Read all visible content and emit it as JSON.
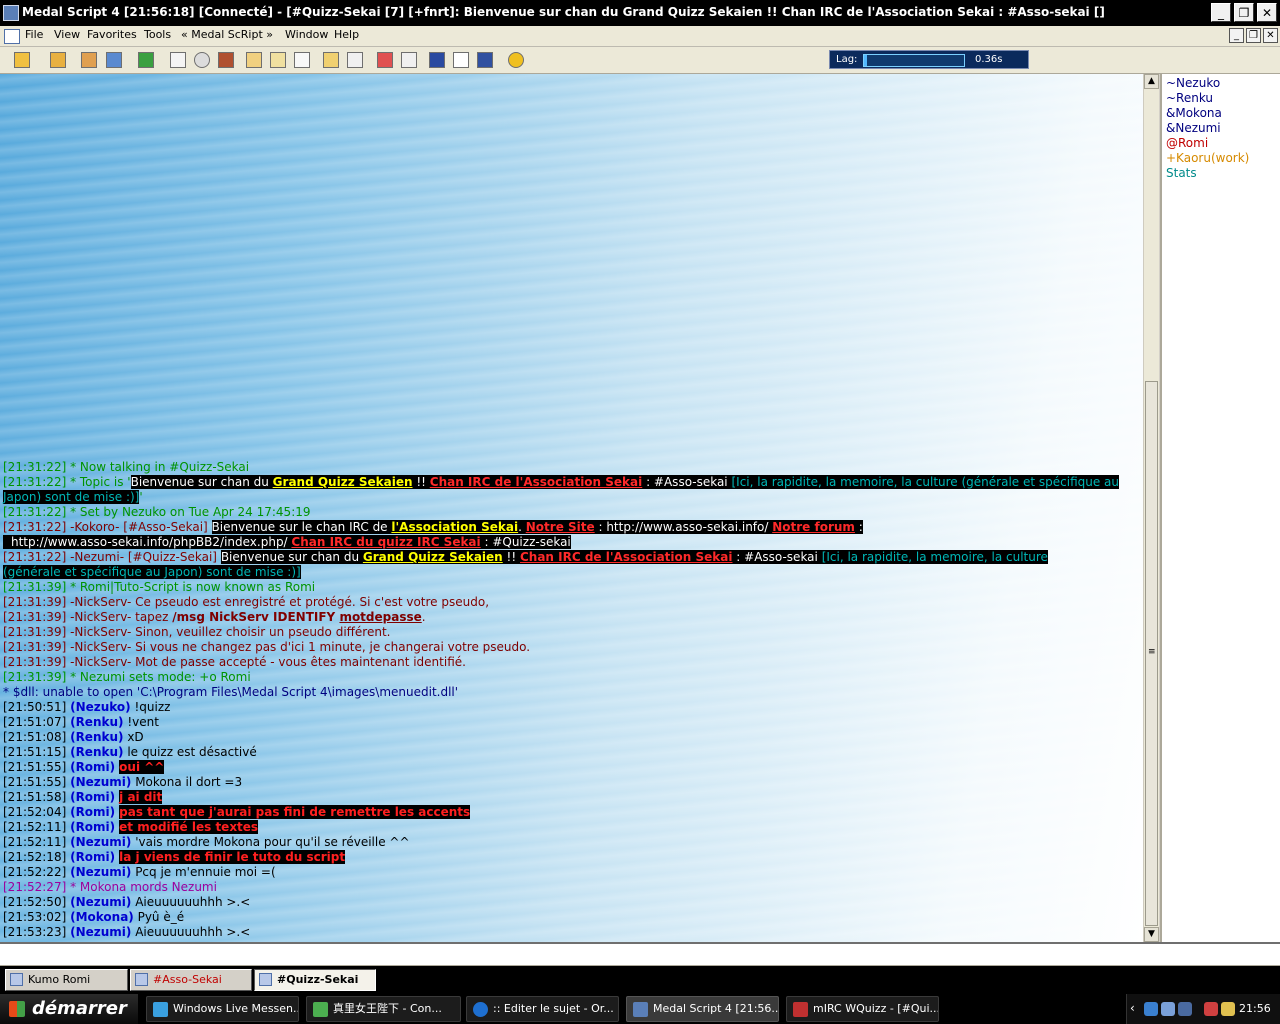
{
  "window": {
    "title": "Medal Script 4 [21:56:18] [Connecté] - [#Quizz-Sekai [7] [+fnrt]: Bienvenue sur chan du Grand Quizz Sekaien !! Chan IRC de l'Association Sekai : #Asso-sekai []",
    "controls": {
      "minimize": "_",
      "restore": "❐",
      "close": "✕"
    }
  },
  "menubar": {
    "items": [
      "File",
      "View",
      "Favorites",
      "Tools",
      "« Medal ScRipt »",
      "Window",
      "Help"
    ],
    "mdi_controls": {
      "minimize": "_",
      "restore": "❐",
      "close": "✕"
    }
  },
  "lag": {
    "label": "Lag:",
    "value": "0.36s",
    "fill_fraction": 0.03
  },
  "chat": {
    "l01": "[21:31:22] * Now talking in #Quizz-Sekai",
    "l02": {
      "prefix": "[21:31:22] * Topic is '",
      "a": "Bienvenue sur chan du ",
      "b": "Grand Quizz Sekaien",
      "c": " !! ",
      "d": "Chan IRC de l'Association Sekai",
      "e": " : #Asso-sekai ",
      "f": "[Ici, la rapidite, la memoire, la culture (générale et spécifique au Japon) sont de mise :)]",
      "g": "'"
    },
    "l03": "[21:31:22] * Set by Nezuko on Tue Apr 24 17:45:19",
    "l04": {
      "prefix": "[21:31:22] -Kokoro- [#Asso-Sekai] ",
      "a": "Bienvenue sur le chan IRC de ",
      "b": "l'Association Sekai",
      "c": ". ",
      "d": "Notre Site",
      "e": " : http://www.asso-sekai.info/ ",
      "f": "Notre forum",
      "g": " : ",
      "h": "http://www.asso-sekai.info/phpBB2/index.php/ ",
      "i": "Chan IRC du quizz IRC Sekai",
      "j": " : #Quizz-sekai "
    },
    "l05": {
      "prefix": "[21:31:22] -Nezumi- [#Quizz-Sekai] ",
      "a": "Bienvenue sur chan du ",
      "b": "Grand Quizz Sekaien",
      "c": " !! ",
      "d": "Chan IRC de l'Association Sekai",
      "e": " : #Asso-sekai ",
      "f": "[Ici, la rapidite, la memoire, la culture (générale et spécifique au Japon) sont de mise :)]"
    },
    "l06": "[21:31:39] * Romi|Tuto-Script is now known as Romi",
    "l07": "[21:31:39] -NickServ- Ce pseudo est enregistré et protégé. Si c'est votre pseudo,",
    "l08": {
      "a": "[21:31:39] -NickServ- tapez ",
      "b": "/msg NickServ IDENTIFY ",
      "c": "motdepasse",
      "d": "."
    },
    "l09": "[21:31:39] -NickServ- Sinon, veuillez choisir un pseudo différent.",
    "l10": "[21:31:39] -NickServ- Si vous ne changez pas d'ici 1 minute, je changerai votre pseudo.",
    "l11": "[21:31:39] -NickServ- Mot de passe accepté - vous êtes maintenant identifié.",
    "l12": "[21:31:39] * Nezumi sets mode: +o Romi",
    "l13": "* $dll: unable to open 'C:\\Program Files\\Medal Script 4\\images\\menuedit.dll'",
    "msgs": [
      {
        "time": "[21:50:51] ",
        "nick": "(Nezuko)",
        "text": " !quizz",
        "hl": false
      },
      {
        "time": "[21:51:07] ",
        "nick": "(Renku)",
        "text": " !vent",
        "hl": false
      },
      {
        "time": "[21:51:08] ",
        "nick": "(Renku)",
        "text": " xD",
        "hl": false
      },
      {
        "time": "[21:51:15] ",
        "nick": "(Renku)",
        "text": " le quizz est désactivé",
        "hl": false
      },
      {
        "time": "[21:51:55] ",
        "nick": "(Romi)",
        "text": "oui ^^",
        "hl": true
      },
      {
        "time": "[21:51:55] ",
        "nick": "(Nezumi)",
        "text": " Mokona il dort =3",
        "hl": false
      },
      {
        "time": "[21:51:58] ",
        "nick": "(Romi)",
        "text": "j ai dit",
        "hl": true
      },
      {
        "time": "[21:52:04] ",
        "nick": "(Romi)",
        "text": "pas tant que j'aurai pas fini de remettre les accents",
        "hl": true
      },
      {
        "time": "[21:52:11] ",
        "nick": "(Romi)",
        "text": "et modifié les textes",
        "hl": true
      },
      {
        "time": "[21:52:11] ",
        "nick": "(Nezumi)",
        "text": " 'vais mordre Mokona pour qu'il se réveille ^^",
        "hl": false
      },
      {
        "time": "[21:52:18] ",
        "nick": "(Romi)",
        "text": "la j viens de finir le tuto du script",
        "hl": true
      },
      {
        "time": "[21:52:22] ",
        "nick": "(Nezumi)",
        "text": " Pcq je m'ennuie moi =(",
        "hl": false
      }
    ],
    "action": "[21:52:27] * Mokona mords Nezumi",
    "msgs2": [
      {
        "time": "[21:52:50] ",
        "nick": "(Nezumi)",
        "text": " Aieuuuuuuhhh >.<"
      },
      {
        "time": "[21:53:02] ",
        "nick": "(Mokona)",
        "text": " Pyû è_é"
      },
      {
        "time": "[21:53:23] ",
        "nick": "(Nezumi)",
        "text": " Aieuuuuuuhhh >.<"
      }
    ]
  },
  "scrollbar": {
    "up": "▲",
    "down": "▼",
    "grip": "≡"
  },
  "nicklist": [
    {
      "nick": "~Nezuko",
      "color": "#00007f"
    },
    {
      "nick": "~Renku",
      "color": "#00007f"
    },
    {
      "nick": "&Mokona",
      "color": "#00007f"
    },
    {
      "nick": "&Nezumi",
      "color": "#00007f"
    },
    {
      "nick": "@Romi",
      "color": "#c00000"
    },
    {
      "nick": "+Kaoru(work)",
      "color": "#d68a00"
    },
    {
      "nick": "Stats",
      "color": "#008b8b"
    }
  ],
  "switchbar": [
    {
      "label": "Kumo Romi",
      "color": "#000000"
    },
    {
      "label": "#Asso-Sekai",
      "color": "#c00000"
    },
    {
      "label": "#Quizz-Sekai",
      "color": "#000000"
    }
  ],
  "taskbar": {
    "start": "démarrer",
    "tasks": [
      {
        "label": "Windows Live Messen...",
        "icon_color": "#3aa0e0"
      },
      {
        "label": "真里女王陛下 - Con...",
        "icon_color": "#4caf50"
      },
      {
        "label": ":: Editer le sujet - Or...",
        "icon_color": "#1e6fd0"
      },
      {
        "label": "Medal Script 4 [21:56...",
        "icon_color": "#5a7fb8"
      },
      {
        "label": "mIRC WQuizz - [#Qui...",
        "icon_color": "#c03030"
      }
    ],
    "clock": "21:56"
  }
}
